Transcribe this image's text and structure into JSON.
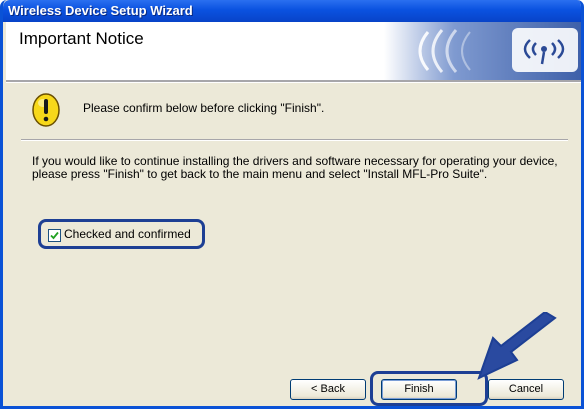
{
  "window": {
    "title": "Wireless Device Setup Wizard"
  },
  "header": {
    "title": "Important Notice"
  },
  "notice": {
    "icon": "warning-icon",
    "text": "Please confirm below before clicking \"Finish\"."
  },
  "body": {
    "text": "If you would like to continue installing the drivers and software necessary for operating your device, please press \"Finish\" to get back to the main menu and select \"Install MFL-Pro Suite\"."
  },
  "confirm": {
    "label": "Checked and confirmed",
    "checked": true
  },
  "buttons": {
    "back": "< Back",
    "finish": "Finish",
    "cancel": "Cancel"
  },
  "colors": {
    "accent": "#1d3f94",
    "titlebar": "#0a52e0",
    "brand_art": "#3d5fa8"
  }
}
